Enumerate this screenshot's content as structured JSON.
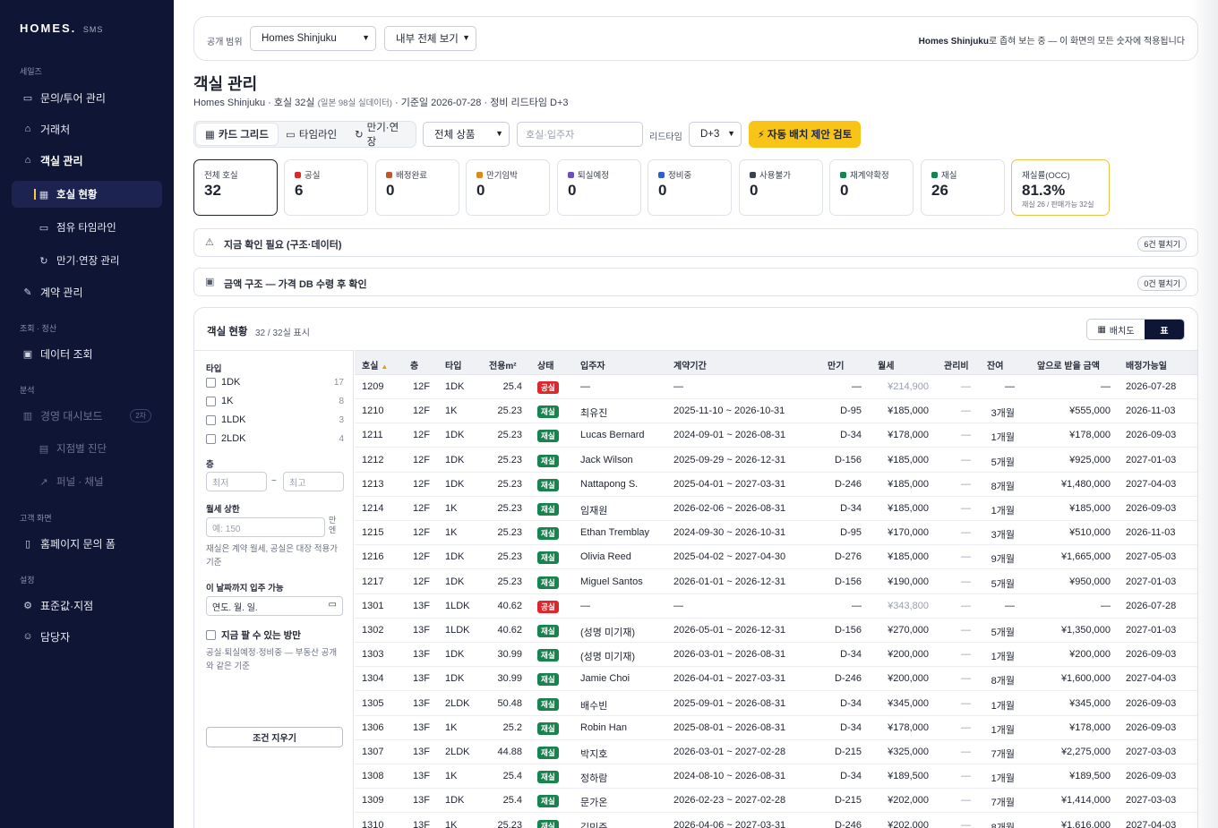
{
  "sidebar": {
    "brand": "HOMES.",
    "brand_sub": "SMS",
    "sections": [
      {
        "label": "세일즈"
      },
      {
        "label": "조회 · 정산"
      },
      {
        "label": "분석"
      },
      {
        "label": "고객 화면"
      },
      {
        "label": "설정"
      }
    ],
    "items": [
      {
        "label": "문의/투어 관리",
        "icon": "inbox-icon"
      },
      {
        "label": "거래처",
        "icon": "building-icon"
      },
      {
        "label": "객실 관리",
        "icon": "home-icon"
      },
      {
        "label": "호실 현황",
        "icon": "grid-icon"
      },
      {
        "label": "점유 타임라인",
        "icon": "calendar-icon"
      },
      {
        "label": "만기·연장 관리",
        "icon": "refresh-icon"
      },
      {
        "label": "계약 관리",
        "icon": "edit-icon"
      },
      {
        "label": "데이터 조회",
        "icon": "database-icon"
      },
      {
        "label": "경영 대시보드",
        "icon": "bar-chart-icon",
        "badge": "2차"
      },
      {
        "label": "지점별 진단",
        "icon": "table-icon"
      },
      {
        "label": "퍼널 · 채널",
        "icon": "trend-icon"
      },
      {
        "label": "홈페이지 문의 폼",
        "icon": "file-icon"
      },
      {
        "label": "표준값·지점",
        "icon": "gear-icon"
      },
      {
        "label": "담당자",
        "icon": "users-icon"
      }
    ]
  },
  "scope": {
    "label": "공개 범위",
    "branch": "Homes Shinjuku",
    "view": "내부 전체 보기",
    "note_bold": "Homes Shinjuku",
    "note_rest": "로 좁혀 보는 중 — 이 화면의 모든 숫자에 적용됩니다"
  },
  "page": {
    "title": "객실 관리",
    "subtitle_a": "Homes Shinjuku · 호실 32실",
    "subtitle_small": "(일본 98실 실데이터)",
    "subtitle_b": "· 기준일 2026-07-28 · 정비 리드타임 D+3"
  },
  "toolbar": {
    "tabs": [
      "카드 그리드",
      "타임라인",
      "만기·연장"
    ],
    "product": "전체 상품",
    "search_placeholder": "호실·입주자",
    "leadtime_label": "리드타임",
    "leadtime": "D+3",
    "auto_button": "자동 배치 제안 검토"
  },
  "stats": [
    {
      "label": "전체 호실",
      "value": "32",
      "color": ""
    },
    {
      "label": "공실",
      "value": "6",
      "color": "#e0262d"
    },
    {
      "label": "배정완료",
      "value": "0",
      "color": "#c0562b"
    },
    {
      "label": "만기임박",
      "value": "0",
      "color": "#d98a1a"
    },
    {
      "label": "퇴실예정",
      "value": "0",
      "color": "#6b4fbf"
    },
    {
      "label": "정비중",
      "value": "0",
      "color": "#2f5fd0"
    },
    {
      "label": "사용불가",
      "value": "0",
      "color": "#3c4150"
    },
    {
      "label": "재계약확정",
      "value": "0",
      "color": "#17844f"
    },
    {
      "label": "재실",
      "value": "26",
      "color": "#17844f"
    },
    {
      "label": "재실률(OCC)",
      "value": "81.3%",
      "foot": "재실 26 / 판매가능 32실"
    }
  ],
  "alerts": [
    {
      "icon": "warning-icon",
      "text": "지금 확인 필요 (구조·데이터)",
      "pill": "6건 펼치기"
    },
    {
      "icon": "money-icon",
      "text": "금액 구조 — 가격 DB 수령 후 확인",
      "pill": "0건 펼치기"
    }
  ],
  "panel": {
    "title": "객실 현황",
    "count": "32 / 32실 표시",
    "toggle_a": "배치도",
    "toggle_b": "표"
  },
  "filters": {
    "type_label": "타입",
    "types": [
      {
        "label": "1DK",
        "count": "17"
      },
      {
        "label": "1K",
        "count": "8"
      },
      {
        "label": "1LDK",
        "count": "3"
      },
      {
        "label": "2LDK",
        "count": "4"
      }
    ],
    "floor_label": "층",
    "floor_min": "최저",
    "floor_sep": "~",
    "floor_max": "최고",
    "rent_label": "월세 상한",
    "rent_placeholder": "예: 150",
    "rent_unit": "만엔",
    "rent_note": "재실은 계약 월세, 공실은 대장 적용가 기준",
    "movein_label": "이 날짜까지 입주 가능",
    "movein_placeholder": "연도. 월. 일.",
    "now_label": "지금 팔 수 있는 방만",
    "now_note": "공실·퇴실예정·정비중 — 부동산 공개와 같은 기준",
    "clear": "조건 지우기"
  },
  "table": {
    "headers": [
      "호실",
      "층",
      "타입",
      "전용m²",
      "상태",
      "입주자",
      "계약기간",
      "만기",
      "월세",
      "관리비",
      "잔여",
      "앞으로 받을 금액",
      "배정가능일"
    ],
    "sort_icon": "▲",
    "rows": [
      [
        "1209",
        "12F",
        "1DK",
        "25.4",
        "공실",
        "—",
        "—",
        "—",
        "¥214,900",
        "—",
        "—",
        "—",
        "2026-07-28"
      ],
      [
        "1210",
        "12F",
        "1K",
        "25.23",
        "재실",
        "최유진",
        "2025-11-10 ~ 2026-10-31",
        "D-95",
        "¥185,000",
        "—",
        "3개월",
        "¥555,000",
        "2026-11-03"
      ],
      [
        "1211",
        "12F",
        "1DK",
        "25.23",
        "재실",
        "Lucas Bernard",
        "2024-09-01 ~ 2026-08-31",
        "D-34",
        "¥178,000",
        "—",
        "1개월",
        "¥178,000",
        "2026-09-03"
      ],
      [
        "1212",
        "12F",
        "1DK",
        "25.23",
        "재실",
        "Jack Wilson",
        "2025-09-29 ~ 2026-12-31",
        "D-156",
        "¥185,000",
        "—",
        "5개월",
        "¥925,000",
        "2027-01-03"
      ],
      [
        "1213",
        "12F",
        "1DK",
        "25.23",
        "재실",
        "Nattapong S.",
        "2025-04-01 ~ 2027-03-31",
        "D-246",
        "¥185,000",
        "—",
        "8개월",
        "¥1,480,000",
        "2027-04-03"
      ],
      [
        "1214",
        "12F",
        "1K",
        "25.23",
        "재실",
        "임재원",
        "2026-02-06 ~ 2026-08-31",
        "D-34",
        "¥185,000",
        "—",
        "1개월",
        "¥185,000",
        "2026-09-03"
      ],
      [
        "1215",
        "12F",
        "1K",
        "25.23",
        "재실",
        "Ethan Tremblay",
        "2024-09-30 ~ 2026-10-31",
        "D-95",
        "¥170,000",
        "—",
        "3개월",
        "¥510,000",
        "2026-11-03"
      ],
      [
        "1216",
        "12F",
        "1DK",
        "25.23",
        "재실",
        "Olivia Reed",
        "2025-04-02 ~ 2027-04-30",
        "D-276",
        "¥185,000",
        "—",
        "9개월",
        "¥1,665,000",
        "2027-05-03"
      ],
      [
        "1217",
        "12F",
        "1DK",
        "25.23",
        "재실",
        "Miguel Santos",
        "2026-01-01 ~ 2026-12-31",
        "D-156",
        "¥190,000",
        "—",
        "5개월",
        "¥950,000",
        "2027-01-03"
      ],
      [
        "1301",
        "13F",
        "1LDK",
        "40.62",
        "공실",
        "—",
        "—",
        "—",
        "¥343,800",
        "—",
        "—",
        "—",
        "2026-07-28"
      ],
      [
        "1302",
        "13F",
        "1LDK",
        "40.62",
        "재실",
        "(성명 미기재)",
        "2026-05-01 ~ 2026-12-31",
        "D-156",
        "¥270,000",
        "—",
        "5개월",
        "¥1,350,000",
        "2027-01-03"
      ],
      [
        "1303",
        "13F",
        "1DK",
        "30.99",
        "재실",
        "(성명 미기재)",
        "2026-03-01 ~ 2026-08-31",
        "D-34",
        "¥200,000",
        "—",
        "1개월",
        "¥200,000",
        "2026-09-03"
      ],
      [
        "1304",
        "13F",
        "1DK",
        "30.99",
        "재실",
        "Jamie Choi",
        "2026-04-01 ~ 2027-03-31",
        "D-246",
        "¥200,000",
        "—",
        "8개월",
        "¥1,600,000",
        "2027-04-03"
      ],
      [
        "1305",
        "13F",
        "2LDK",
        "50.48",
        "재실",
        "배수빈",
        "2025-09-01 ~ 2026-08-31",
        "D-34",
        "¥345,000",
        "—",
        "1개월",
        "¥345,000",
        "2026-09-03"
      ],
      [
        "1306",
        "13F",
        "1K",
        "25.2",
        "재실",
        "Robin Han",
        "2025-08-01 ~ 2026-08-31",
        "D-34",
        "¥178,000",
        "—",
        "1개월",
        "¥178,000",
        "2026-09-03"
      ],
      [
        "1307",
        "13F",
        "2LDK",
        "44.88",
        "재실",
        "박지호",
        "2026-03-01 ~ 2027-02-28",
        "D-215",
        "¥325,000",
        "—",
        "7개월",
        "¥2,275,000",
        "2027-03-03"
      ],
      [
        "1308",
        "13F",
        "1K",
        "25.4",
        "재실",
        "정하람",
        "2024-08-10 ~ 2026-08-31",
        "D-34",
        "¥189,500",
        "—",
        "1개월",
        "¥189,500",
        "2026-09-03"
      ],
      [
        "1309",
        "13F",
        "1DK",
        "25.4",
        "재실",
        "문가온",
        "2026-02-23 ~ 2027-02-28",
        "D-215",
        "¥202,000",
        "—",
        "7개월",
        "¥1,414,000",
        "2027-03-03"
      ],
      [
        "1310",
        "13F",
        "1K",
        "25.23",
        "재실",
        "김민준",
        "2026-04-06 ~ 2027-03-31",
        "D-246",
        "¥202,000",
        "—",
        "8개월",
        "¥1,616,000",
        "2027-04-03"
      ]
    ]
  }
}
